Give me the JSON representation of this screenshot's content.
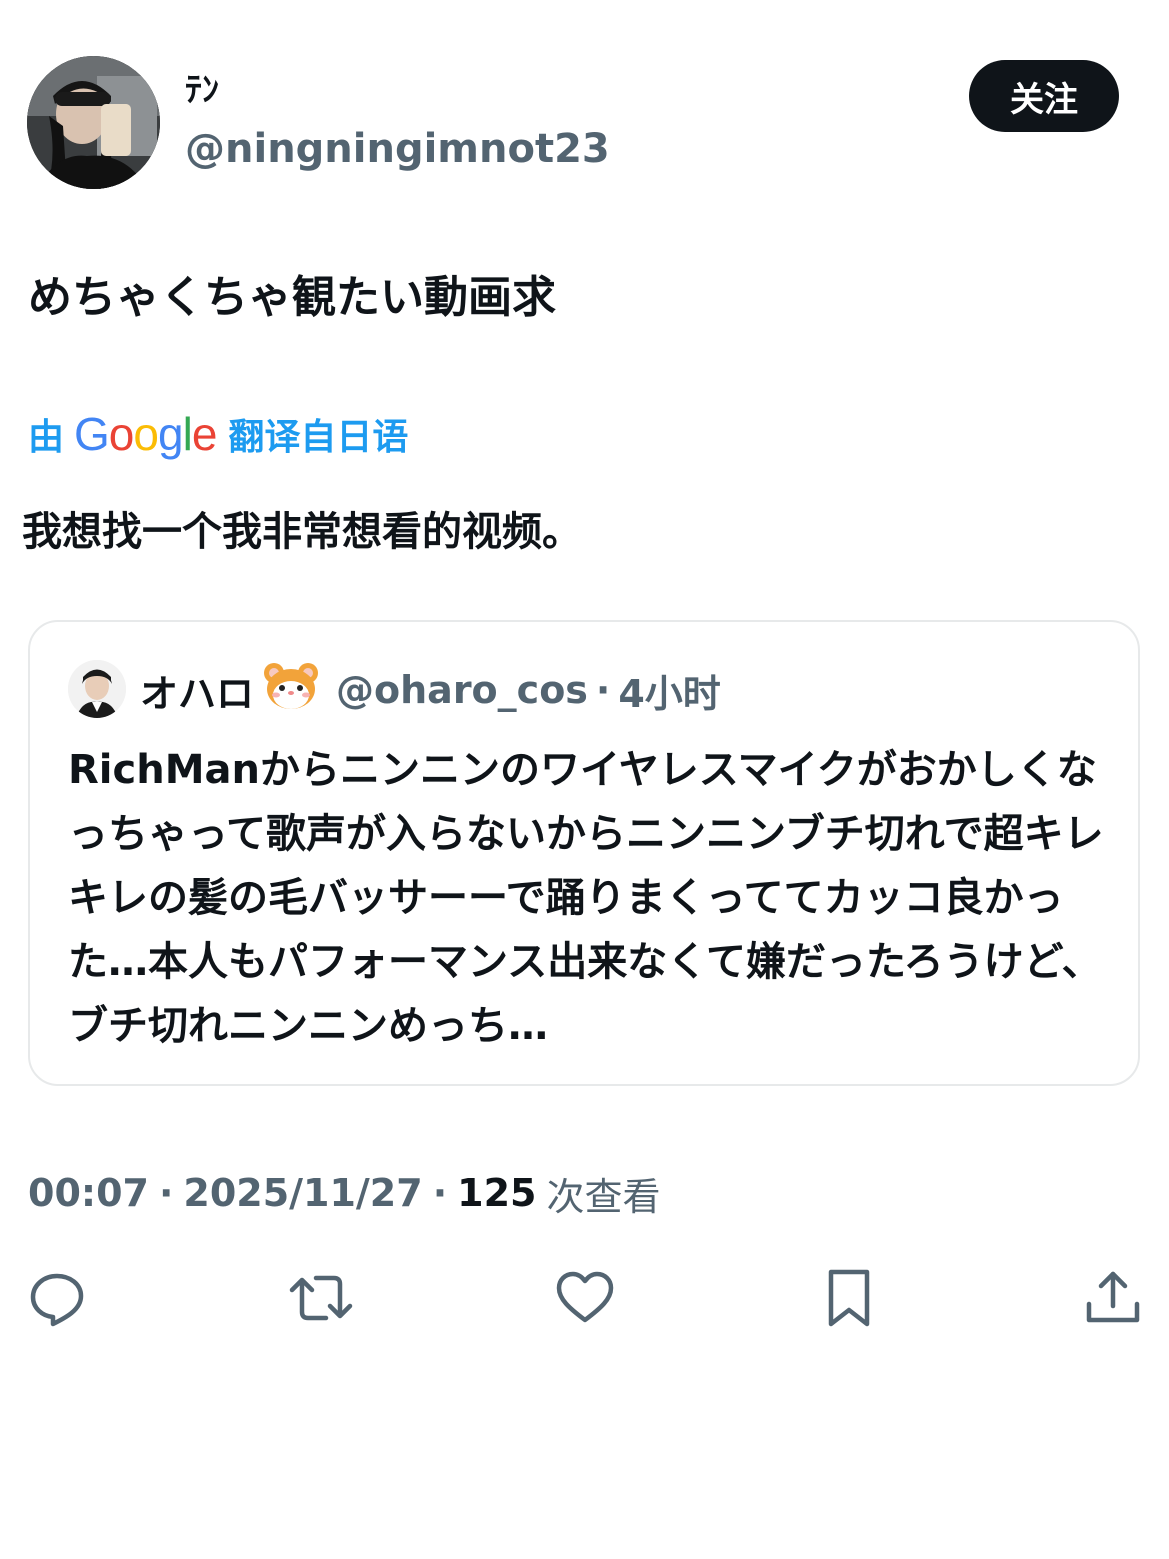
{
  "author": {
    "display_name": "ﾃﾝ",
    "handle": "@ningningimnot23",
    "follow_label": "关注"
  },
  "tweet": {
    "text": "めちゃくちゃ観たい動画求",
    "translation": {
      "prefix": "由",
      "brand": "Google",
      "suffix": "翻译自日语",
      "text": "我想找一个我非常想看的视频。"
    }
  },
  "quoted": {
    "display_name": "オハロ",
    "emoji": "🐹",
    "handle": "@oharo_cos",
    "separator": "·",
    "time": "4小时",
    "text": "RichManからニンニンのワイヤレスマイクがおかしくなっちゃって歌声が入らないからニンニンブチ切れで超キレキレの髪の毛バッサーーで踊りまくっててカッコ良かった…本人もパフォーマンス出来なくて嫌だったろうけど、ブチ切れニンニンめっち…"
  },
  "meta": {
    "time": "00:07",
    "separator": "·",
    "date": "2025/11/27",
    "views_count": "125",
    "views_label": "次查看"
  },
  "actions": [
    {
      "icon": "reply-icon"
    },
    {
      "icon": "retweet-icon"
    },
    {
      "icon": "like-icon"
    },
    {
      "icon": "bookmark-icon"
    },
    {
      "icon": "share-icon"
    }
  ],
  "colors": {
    "text": "#0f1419",
    "muted": "#536471",
    "accent": "#1d9bf0",
    "border": "#e7e9ea",
    "button_bg": "#0f1419"
  }
}
